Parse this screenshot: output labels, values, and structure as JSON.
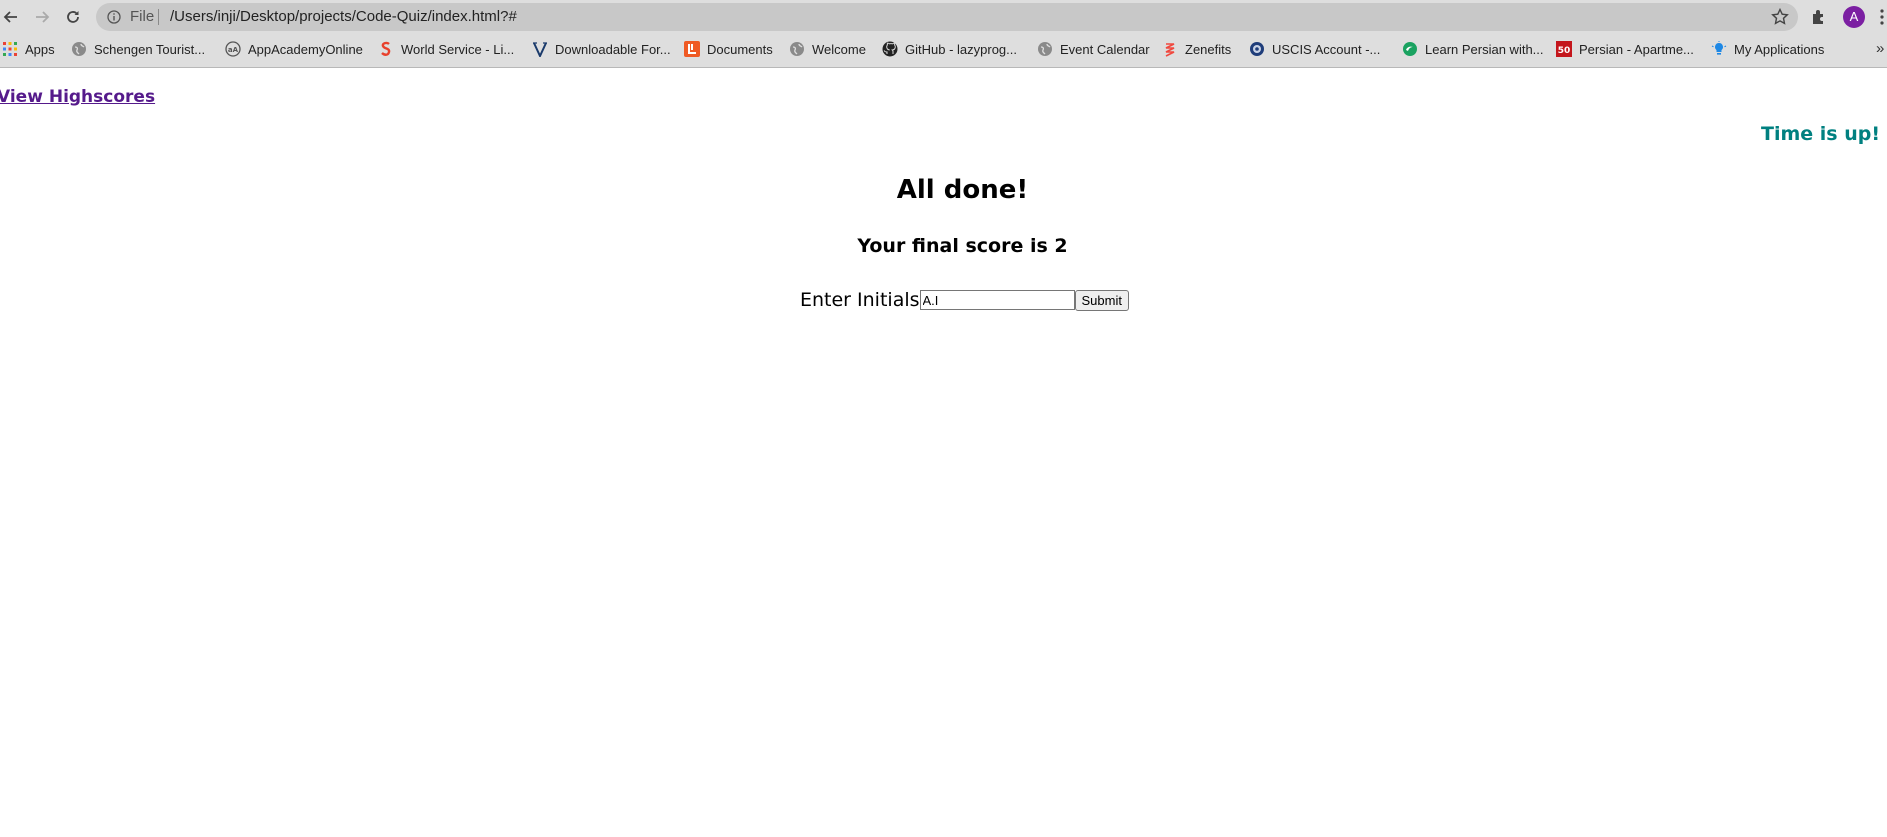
{
  "browser": {
    "url_scheme": "File",
    "url": "/Users/inji/Desktop/projects/Code-Quiz/index.html?#",
    "profile_initial": "A",
    "bookmarks": [
      {
        "label": "Apps",
        "icon": "apps-grid-icon"
      },
      {
        "label": "Schengen Tourist...",
        "icon": "globe-icon"
      },
      {
        "label": "AppAcademyOnline",
        "icon": "appacademy-logo-icon"
      },
      {
        "label": "World Service - Li...",
        "icon": "world-service-icon"
      },
      {
        "label": "Downloadable For...",
        "icon": "v-logo-icon"
      },
      {
        "label": "Documents",
        "icon": "documents-icon"
      },
      {
        "label": "Welcome",
        "icon": "globe-icon"
      },
      {
        "label": "GitHub - lazyprog...",
        "icon": "github-icon"
      },
      {
        "label": "Event Calendar",
        "icon": "globe-icon"
      },
      {
        "label": "Zenefits",
        "icon": "zenefits-icon"
      },
      {
        "label": "USCIS Account -...",
        "icon": "uscis-seal-icon"
      },
      {
        "label": "Learn Persian with...",
        "icon": "learn-persian-icon"
      },
      {
        "label": "Persian - Apartme...",
        "icon": "fifty-badge-icon"
      },
      {
        "label": "My Applications",
        "icon": "lightbulb-icon"
      }
    ],
    "more_bookmarks": "»"
  },
  "page": {
    "highscores_link": "View Highscores",
    "timer_text": "Time is up!",
    "title": "All done!",
    "score_text": "Your final score is 2",
    "initials_label": "Enter Initials",
    "initials_value": "A.I",
    "submit_label": "Submit"
  },
  "colors": {
    "visited_link": "#551a8b",
    "timer": "#008080",
    "avatar": "#7b1fa2"
  }
}
